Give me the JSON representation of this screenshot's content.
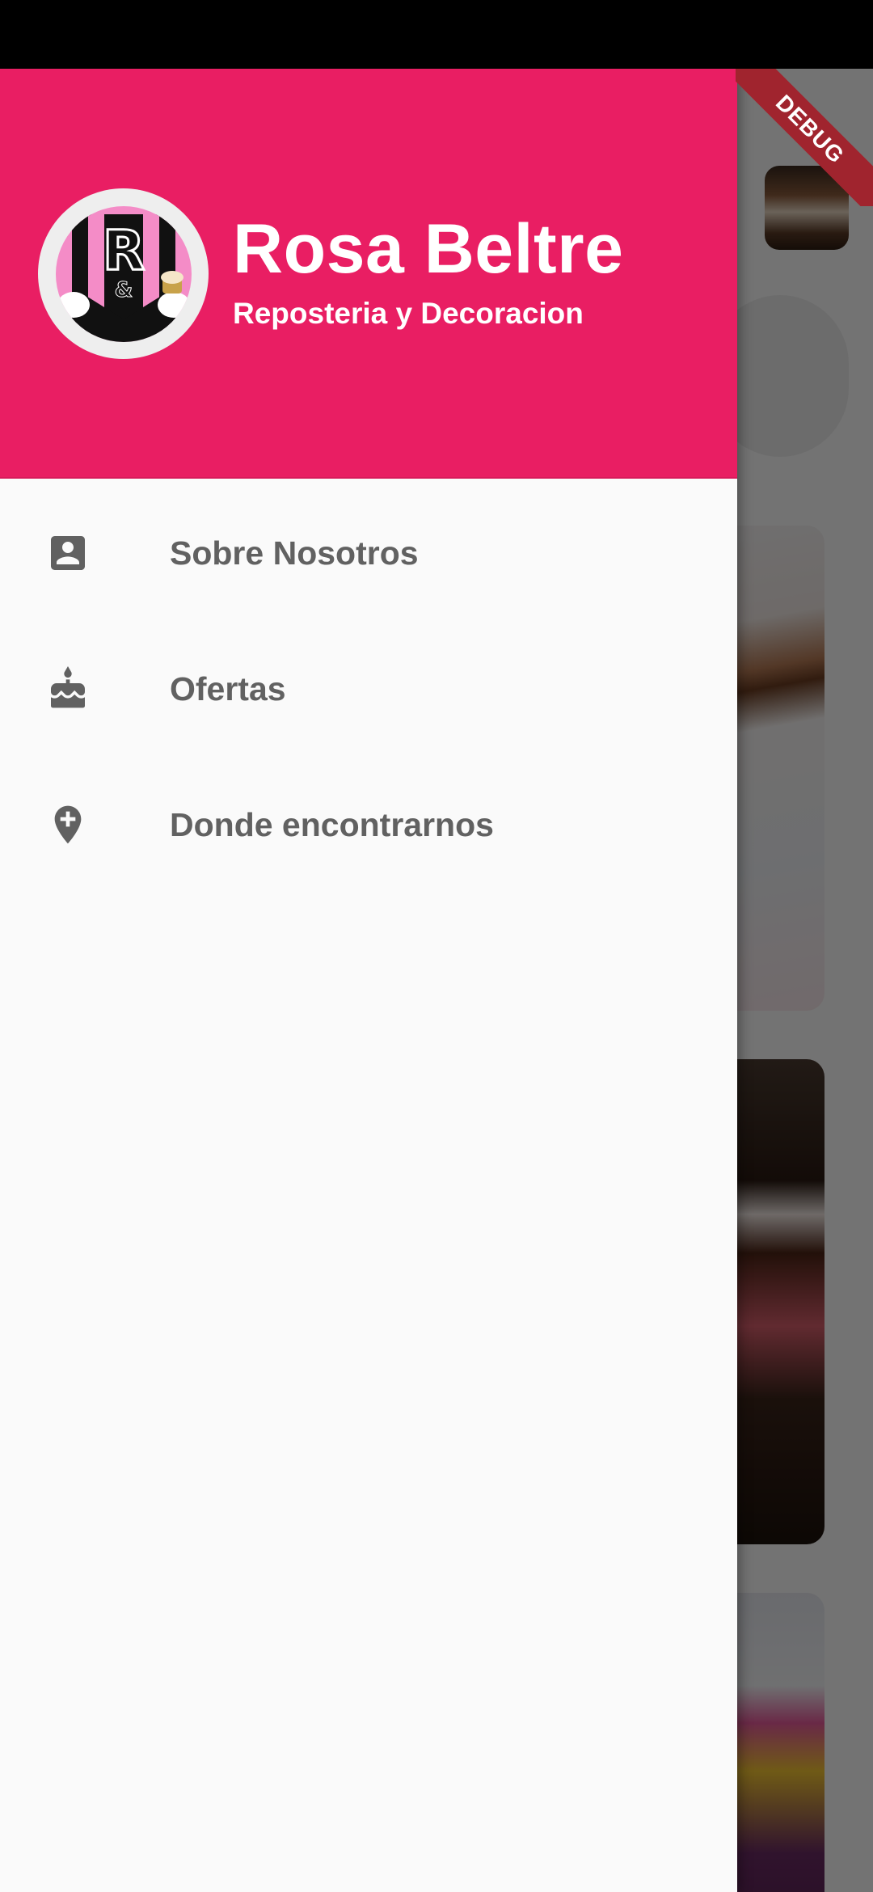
{
  "drawer": {
    "header": {
      "title": "Rosa Beltre",
      "subtitle": "Reposteria y Decoracion"
    },
    "items": [
      {
        "label": "Sobre Nosotros",
        "icon": "account-box-icon"
      },
      {
        "label": "Ofertas",
        "icon": "cake-icon"
      },
      {
        "label": "Donde encontrarnos",
        "icon": "add-location-icon"
      }
    ]
  },
  "debug_banner": "DEBUG",
  "colors": {
    "header": "#e91e63",
    "icon": "#616161",
    "label": "#616161",
    "drawer_bg": "#fafafa",
    "debug": "#a0242e"
  }
}
